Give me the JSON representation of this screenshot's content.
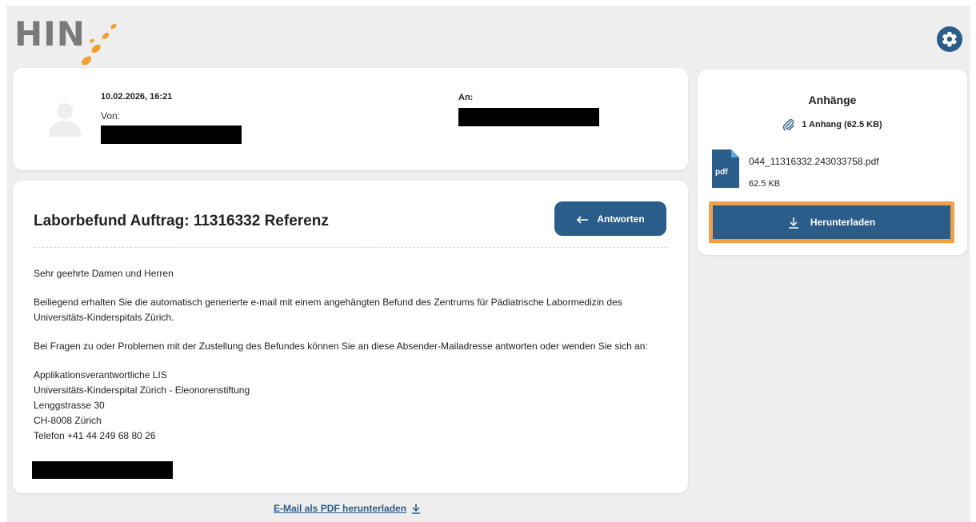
{
  "brand": {
    "logo_text": "HIN",
    "accent": "#2a5d8a",
    "highlight": "#f0a04b",
    "logo_dot_color": "#f0a030"
  },
  "header": {
    "settings_icon": "gear-icon"
  },
  "message_meta": {
    "date": "10.02.2026, 16:21",
    "from_label": "Von:",
    "to_label": "An:"
  },
  "message": {
    "subject": "Laborbefund Auftrag: 11316332 Referenz",
    "reply_label": "Antworten",
    "greeting": "Sehr geehrte Damen und Herren",
    "paragraph1": "Beiliegend erhalten Sie die automatisch generierte e-mail mit einem angehängten Befund des Zentrums für Pädiatrische Labormedizin des Universitäts-Kinderspitals Zürich.",
    "paragraph2": "Bei Fragen zu oder Problemen mit der Zustellung des Befundes können Sie an diese Absender-Mailadresse antworten oder wenden Sie sich an:",
    "address": [
      "Applikationsverantwortliche LIS",
      "Universitäts-Kinderspital Zürich - Eleonorenstiftung",
      "Lenggstrasse 30",
      "CH-8008 Zürich",
      "Telefon +41 44 249 68 80 26"
    ]
  },
  "footer": {
    "pdf_link": "E-Mail als PDF herunterladen"
  },
  "attachments": {
    "title": "Anhänge",
    "count_label": "1 Anhang (62.5 KB)",
    "file_type": "pdf",
    "file_name": "044_11316332.243033758.pdf",
    "file_size": "62.5 KB",
    "download_label": "Herunterladen"
  }
}
